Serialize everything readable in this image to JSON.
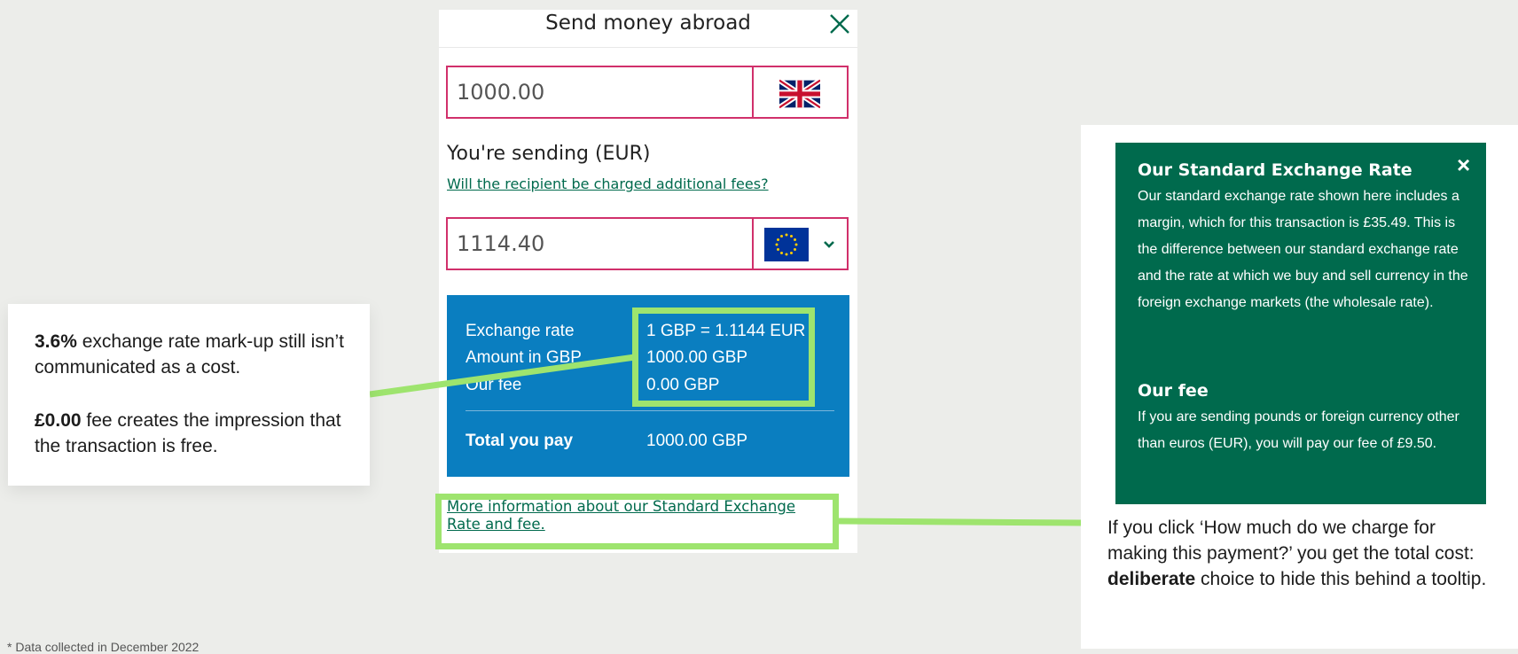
{
  "app": {
    "title": "Send money abroad",
    "close_icon": "close-icon"
  },
  "send": {
    "amount": "1000.00",
    "currency_flag": "uk-flag-icon"
  },
  "receive": {
    "label": "You're sending (EUR)",
    "fees_link": "Will the recipient be charged additional fees?",
    "amount": "1114.40",
    "currency_flag": "eu-flag-icon",
    "dropdown_icon": "chevron-down-icon"
  },
  "rate_panel": {
    "exchange_rate_label": "Exchange rate",
    "exchange_rate_value": "1 GBP = 1.1144 EUR",
    "amount_gbp_label": "Amount in GBP",
    "amount_gbp_value": "1000.00 GBP",
    "fee_label": "Our fee",
    "fee_value": "0.00 GBP",
    "total_label": "Total you pay",
    "total_value": "1000.00 GBP"
  },
  "more_info_link": "More information about our Standard Exchange Rate and fee.",
  "left_note": {
    "p1_bold": "3.6%",
    "p1_text": " exchange rate mark-up still isn’t communicated as a cost.",
    "p2_bold": "£0.00",
    "p2_text": " fee creates the impression that the transaction is free."
  },
  "tooltip": {
    "heading1": "Our Standard Exchange Rate",
    "body1": "Our standard exchange rate shown here includes a margin, which for this transaction is £35.49. This is the difference between our standard exchange rate and the rate at which we buy and sell currency in the foreign exchange markets (the wholesale rate).",
    "heading2": "Our fee",
    "body2": "If you are sending pounds or foreign currency other than euros (EUR), you will pay our fee of £9.50.",
    "close": "×"
  },
  "right_note": {
    "text_a": "If you click ‘How much do we charge for making this payment?’ you get the total cost: ",
    "text_bold": "deliberate",
    "text_b": " choice to hide this behind a tooltip."
  },
  "footnote": "* Data collected in December 2022",
  "colors": {
    "background": "#ecedea",
    "brand_green": "#006a4d",
    "rate_panel_blue": "#0a7ec0",
    "input_border": "#d1306b",
    "highlight_green": "#9ee46e"
  }
}
